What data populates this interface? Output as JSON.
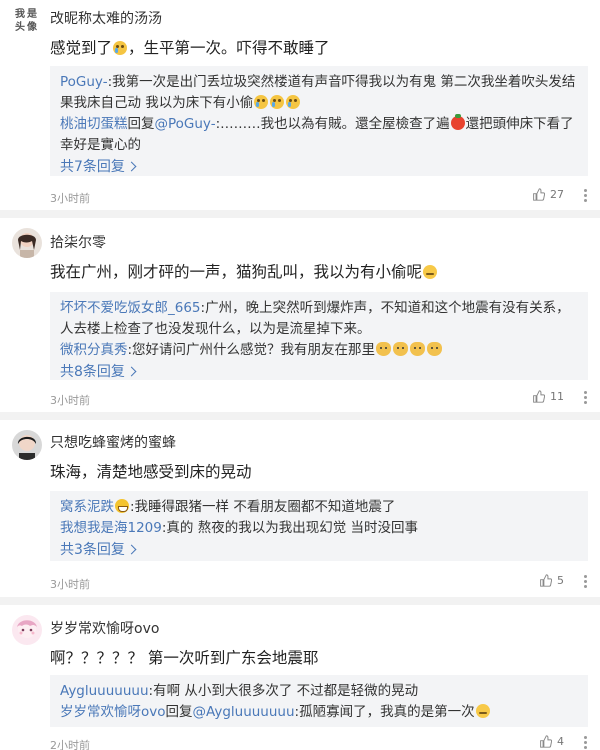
{
  "comments": [
    {
      "avatar_text": "我是\n头像",
      "username": "改昵称太难的汤汤",
      "text": "感觉到了",
      "text_after_emoji": "，生平第一次。吓得不敢睡了",
      "replies": [
        {
          "name": "PoGuy-",
          "text": ":我第一次是出门丢垃圾突然楼道有声音吓得我以为有鬼 第二次我坐着吹头发结果我床自己动 我以为床下有小偷"
        },
        {
          "name": "桃油切蛋糕",
          "mid": "回复",
          "target": "@PoGuy-",
          "text": ":………我也以為有賊。還全屋檢查了遍",
          "text2": "還把頭伸床下看了幸好是實心的"
        }
      ],
      "more_replies": "共7条回复",
      "time": "3小时前",
      "likes": "27"
    },
    {
      "username": "拾柒尔零",
      "text": "我在广州，刚才砰的一声，猫狗乱叫，我以为有小偷呢",
      "replies": [
        {
          "name": "坏坏不爱吃饭女郎_665",
          "text": ":广州，晚上突然听到爆炸声，不知道和这个地震有没有关系，人去楼上检查了也没发现什么，以为是流星掉下来。"
        },
        {
          "name": "微积分真秀",
          "text": ":您好请问广州什么感觉？我有朋友在那里"
        }
      ],
      "more_replies": "共8条回复",
      "time": "3小时前",
      "likes": "11"
    },
    {
      "username": "只想吃蜂蜜烤的蜜蜂",
      "text": "珠海，清楚地感受到床的晃动",
      "replies": [
        {
          "name": "窝系泥跌",
          "text": ":我睡得跟猪一样 不看朋友圈都不知道地震了"
        },
        {
          "name": "我想我是海1209",
          "text": ":真的 熬夜的我以为我出现幻觉 当时没回事"
        }
      ],
      "more_replies": "共3条回复",
      "time": "3小时前",
      "likes": "5"
    },
    {
      "username": "岁岁常欢愉呀ovo",
      "text": "啊？？？？？ 第一次听到广东会地震耶",
      "replies": [
        {
          "name": "Aygluuuuuuu",
          "text": ":有啊 从小到大很多次了 不过都是轻微的晃动"
        },
        {
          "name": "岁岁常欢愉呀ovo",
          "mid": "回复",
          "target": "@Aygluuuuuuu",
          "text": ":孤陋寡闻了，我真的是第一次"
        }
      ],
      "time": "2小时前",
      "likes": "4"
    }
  ],
  "icons": {
    "like": "thumbs-up-icon",
    "more": "more-vertical-icon"
  },
  "colors": {
    "link": "#4a78b8",
    "reply_bg": "#f3f4f6",
    "separator": "#f2f2f2"
  }
}
